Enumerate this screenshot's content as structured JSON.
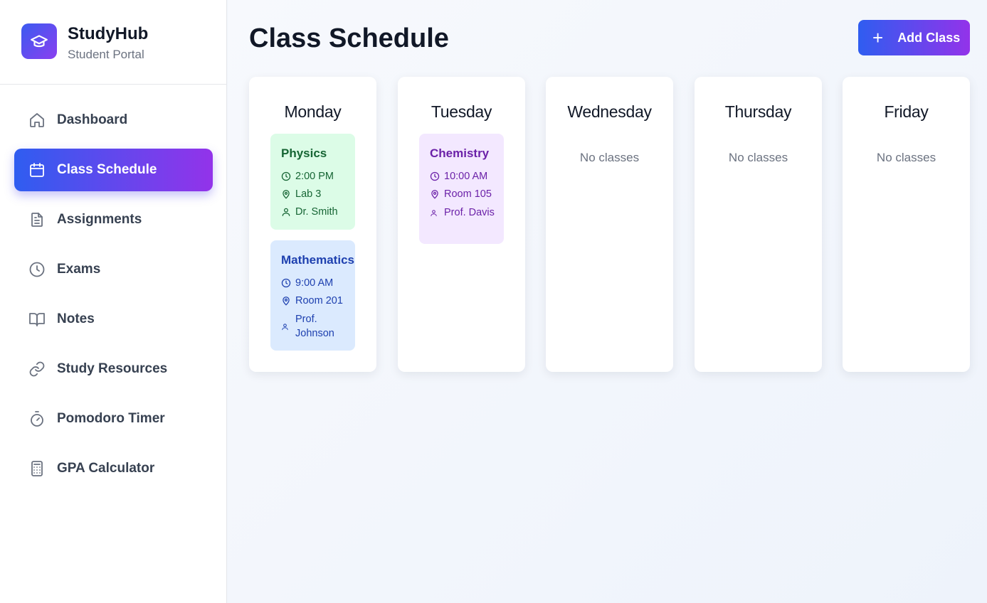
{
  "app": {
    "name": "StudyHub",
    "subtitle": "Student Portal"
  },
  "sidebar": {
    "items": [
      {
        "label": "Dashboard",
        "icon": "home-icon",
        "active": false
      },
      {
        "label": "Class Schedule",
        "icon": "calendar-icon",
        "active": true
      },
      {
        "label": "Assignments",
        "icon": "document-icon",
        "active": false
      },
      {
        "label": "Exams",
        "icon": "clock-icon",
        "active": false
      },
      {
        "label": "Notes",
        "icon": "book-icon",
        "active": false
      },
      {
        "label": "Study Resources",
        "icon": "link-icon",
        "active": false
      },
      {
        "label": "Pomodoro Timer",
        "icon": "timer-icon",
        "active": false
      },
      {
        "label": "GPA Calculator",
        "icon": "calculator-icon",
        "active": false
      }
    ]
  },
  "header": {
    "title": "Class Schedule",
    "add_button": "Add Class",
    "add_icon": "+"
  },
  "days": [
    {
      "name": "Monday",
      "classes": [
        {
          "name": "Physics",
          "time": "2:00 PM",
          "room": "Lab 3",
          "instructor": "Dr. Smith",
          "color": "#dcfce7"
        },
        {
          "name": "Mathematics",
          "time": "9:00 AM",
          "room": "Room 201",
          "instructor": "Prof. Johnson",
          "color": "#dbeafe"
        }
      ]
    },
    {
      "name": "Tuesday",
      "classes": [
        {
          "name": "Chemistry",
          "time": "10:00 AM",
          "room": "Room 105",
          "instructor": "Prof. Davis",
          "color": "#f3e8ff"
        }
      ]
    },
    {
      "name": "Wednesday",
      "classes": [],
      "empty_text": "No classes"
    },
    {
      "name": "Thursday",
      "classes": [],
      "empty_text": "No classes"
    },
    {
      "name": "Friday",
      "classes": [],
      "empty_text": "No classes"
    }
  ],
  "colors": {
    "accent_start": "#2f5df0",
    "accent_end": "#9333ea"
  }
}
